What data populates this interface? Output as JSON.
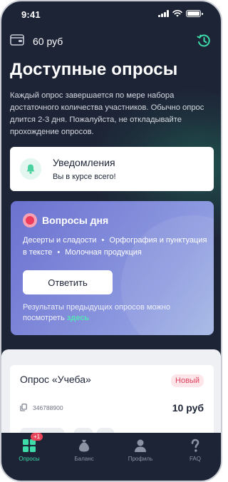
{
  "status_bar": {
    "time": "9:41"
  },
  "header": {
    "balance": "60 руб",
    "title": "Доступные опросы",
    "description": "Каждый опрос завершается по мере набора достаточного количества участников. Обычно опрос длится 2-3 дня. Пожалуйста, не откладывайте прохождение опросов."
  },
  "notifications": {
    "title": "Уведомления",
    "subtitle": "Вы в курсе всего!"
  },
  "questions_of_day": {
    "title": "Вопросы дня",
    "topics": [
      "Десерты и сладости",
      "Орфография и пунктуация в тексте",
      "Молочная продукция"
    ],
    "answer_label": "Ответить",
    "results_text": "Результаты предыдущих опросов можно посмотреть",
    "results_link": "здесь"
  },
  "survey_card": {
    "title": "Опрос «Учеба»",
    "badge": "Новый",
    "id": "346788900",
    "price": "10 руб"
  },
  "bottom_nav": {
    "items": [
      {
        "label": "Опросы",
        "badge": "+1",
        "icon": "grid-icon"
      },
      {
        "label": "Баланс",
        "icon": "moneybag-icon"
      },
      {
        "label": "Профиль",
        "icon": "person-icon"
      },
      {
        "label": "FAQ",
        "icon": "question-icon"
      }
    ]
  },
  "colors": {
    "background": "#1d2436",
    "accent": "#3ddca9",
    "badge_red": "#e8455a",
    "card_gradient_start": "#6a72cf",
    "card_gradient_end": "#a3b6e4"
  }
}
